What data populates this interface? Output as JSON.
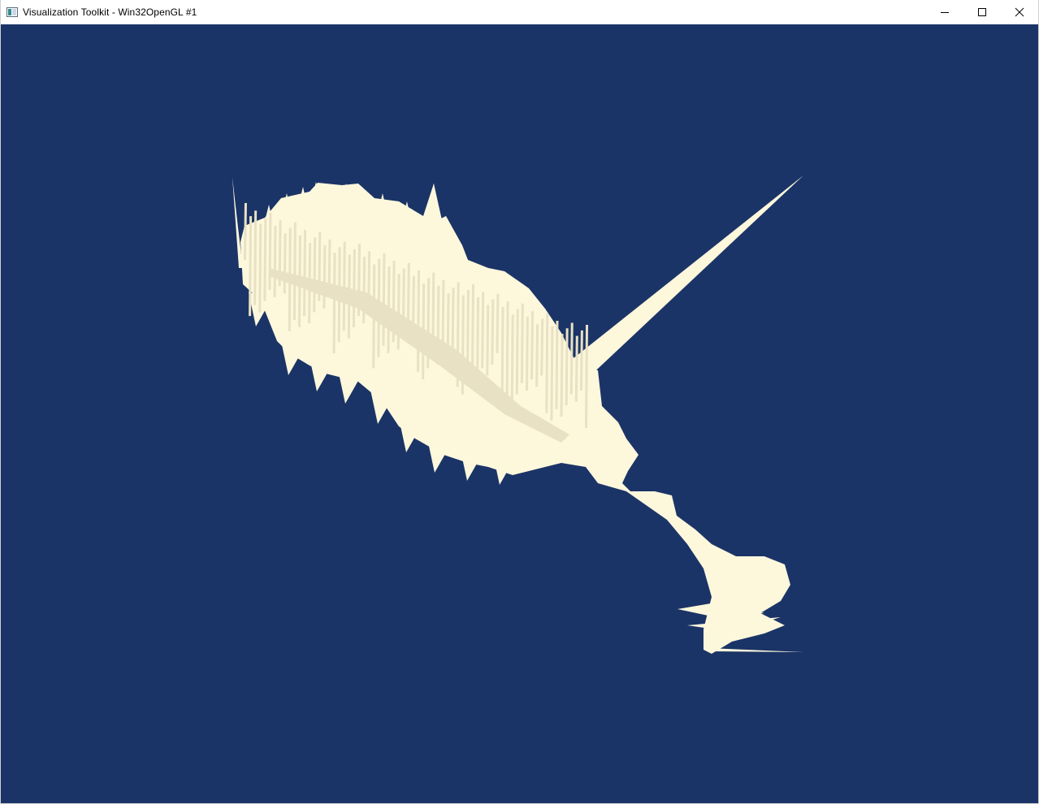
{
  "window": {
    "title": "Visualization Toolkit - Win32OpenGL #1",
    "icon": "vtk-window-icon",
    "controls": {
      "minimize_icon": "minimize-icon",
      "maximize_icon": "maximize-icon",
      "close_icon": "close-icon"
    }
  },
  "viewport": {
    "background_color": "#1b3467",
    "surface_color": "#fdf7dc",
    "shade_color": "#e8e1c4"
  }
}
